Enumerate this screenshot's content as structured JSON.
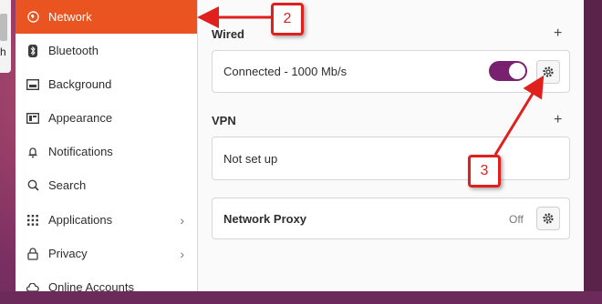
{
  "desktop": {
    "label": "h"
  },
  "sidebar": {
    "items": [
      {
        "label": "Network",
        "icon": "globe-icon",
        "active": true
      },
      {
        "label": "Bluetooth",
        "icon": "bluetooth-icon"
      },
      {
        "label": "Background",
        "icon": "background-icon"
      },
      {
        "label": "Appearance",
        "icon": "appearance-icon"
      },
      {
        "label": "Notifications",
        "icon": "bell-icon"
      },
      {
        "label": "Search",
        "icon": "search-icon"
      },
      {
        "label": "Applications",
        "icon": "grid-icon",
        "chevron": true
      },
      {
        "label": "Privacy",
        "icon": "lock-icon",
        "chevron": true
      },
      {
        "label": "Online Accounts",
        "icon": "cloud-icon"
      }
    ]
  },
  "main": {
    "wired": {
      "title": "Wired",
      "status": "Connected - 1000 Mb/s",
      "toggle_on": true
    },
    "vpn": {
      "title": "VPN",
      "status": "Not set up"
    },
    "proxy": {
      "title": "Network Proxy",
      "status": "Off"
    }
  },
  "annotations": {
    "callout_2": "2",
    "callout_3": "3"
  },
  "colors": {
    "accent": "#e95420",
    "toggle": "#77216f",
    "annotation": "#e0201d"
  }
}
